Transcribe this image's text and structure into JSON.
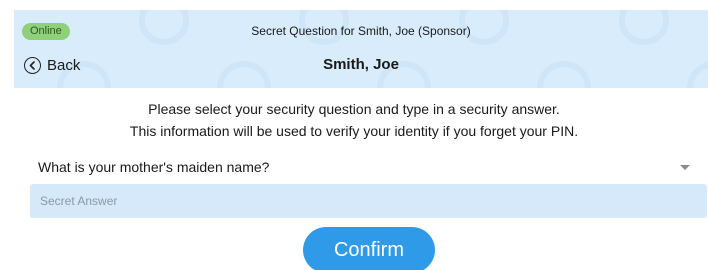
{
  "header": {
    "status_badge": "Online",
    "title": "Secret Question for Smith, Joe  (Sponsor)",
    "back_label": "Back",
    "name": "Smith, Joe"
  },
  "instructions": {
    "line1": "Please select your security question and type in a security answer.",
    "line2": "This information will be used to verify your identity if you forget your PIN."
  },
  "question_select": {
    "selected": "What is your mother's maiden name?"
  },
  "answer_field": {
    "value": "",
    "placeholder": "Secret Answer"
  },
  "confirm_label": "Confirm",
  "colors": {
    "header_bg": "#d8ecfb",
    "online_badge": "#8fd07a",
    "input_bg": "#d6e9fb",
    "confirm_bg": "#2f9be8"
  },
  "icons": {
    "back": "chevron-left-circle-icon",
    "select": "caret-down-icon"
  }
}
